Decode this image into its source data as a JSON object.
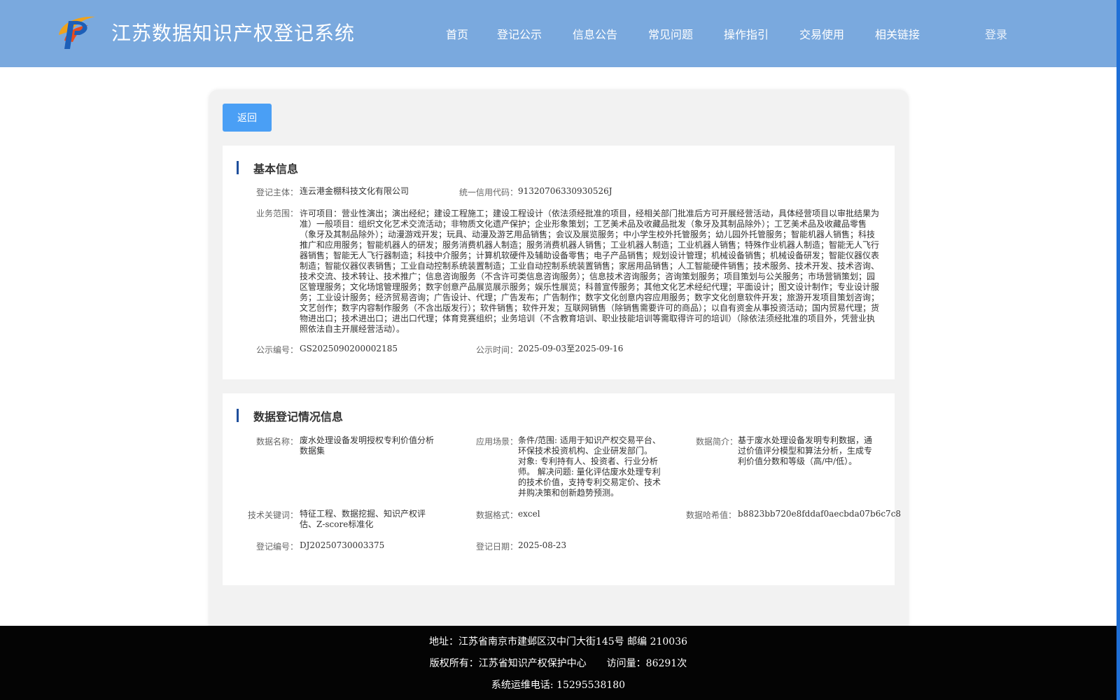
{
  "header": {
    "title": "江苏数据知识产权登记系统",
    "nav": [
      "首页",
      "登记公示",
      "信息公告",
      "常见问题",
      "操作指引",
      "交易使用",
      "相关链接"
    ],
    "login": "登录"
  },
  "toolbar": {
    "back_label": "返回"
  },
  "basic_info": {
    "title": "基本信息",
    "subject_label": "登记主体：",
    "subject": "连云港金棚科技文化有限公司",
    "credit_label": "统一信用代码：",
    "credit_code": "91320706330930526J",
    "scope_label": "业务范围：",
    "scope": "许可项目：营业性演出；演出经纪；建设工程施工；建设工程设计（依法须经批准的项目，经相关部门批准后方可开展经营活动，具体经营项目以审批结果为准）一般项目：组织文化艺术交流活动；非物质文化遗产保护；企业形象策划；工艺美术品及收藏品批发（象牙及其制品除外）；工艺美术品及收藏品零售（象牙及其制品除外）；动漫游戏开发；玩具、动漫及游艺用品销售；会议及展览服务；中小学生校外托管服务；幼儿园外托管服务；智能机器人销售；科技推广和应用服务；智能机器人的研发；服务消费机器人制造；服务消费机器人销售；工业机器人制造；工业机器人销售；特殊作业机器人制造；智能无人飞行器销售；智能无人飞行器制造；科技中介服务；计算机软硬件及辅助设备零售；电子产品销售；规划设计管理；机械设备销售；机械设备研发；智能仪器仪表制造；智能仪器仪表销售；工业自动控制系统装置制造；工业自动控制系统装置销售；家居用品销售；人工智能硬件销售；技术服务、技术开发、技术咨询、技术交流、技术转让、技术推广；信息咨询服务（不含许可类信息咨询服务）；信息技术咨询服务；咨询策划服务；项目策划与公关服务；市场营销策划；园区管理服务；文化场馆管理服务；数字创意产品展览展示服务；娱乐性展览；科普宣传服务；其他文化艺术经纪代理；平面设计；图文设计制作；专业设计服务；工业设计服务；经济贸易咨询；广告设计、代理；广告发布；广告制作；数字文化创意内容应用服务；数字文化创意软件开发；旅游开发项目策划咨询；文艺创作；数字内容制作服务（不含出版发行）；软件销售；软件开发；互联网销售（除销售需要许可的商品）；以自有资金从事投资活动；国内贸易代理；货物进出口；技术进出口；进出口代理；体育竞赛组织；业务培训（不含教育培训、职业技能培训等需取得许可的培训）（除依法须经批准的项目外，凭营业执照依法自主开展经营活动）。",
    "pub_no_label": "公示编号：",
    "pub_no": "GS2025090200002185",
    "pub_time_label": "公示时间：",
    "pub_time": "2025-09-03至2025-09-16"
  },
  "data_info": {
    "title": "数据登记情况信息",
    "name_label": "数据名称：",
    "name": "废水处理设备发明授权专利价值分析数据集",
    "scenario_label": "应用场景：",
    "scenario": "条件/范围: 适用于知识产权交易平台、环保技术投资机构、企业研发部门。 对象: 专利持有人、投资者、行业分析师。 解决问题: 量化评估废水处理专利的技术价值，支持专利交易定价、技术并购决策和创新趋势预测。",
    "intro_label": "数据简介：",
    "intro": "基于废水处理设备发明专利数据，通过价值评分模型和算法分析，生成专利价值分数和等级（高/中/低）。",
    "keywords_label": "技术关键词：",
    "keywords": "特征工程、数据挖掘、知识产权评估、Z-score标准化",
    "format_label": "数据格式：",
    "format": "excel",
    "hash_label": "数据哈希值：",
    "hash": "b8823bb720e8fddaf0aecbda07b6c7c8",
    "reg_no_label": "登记编号：",
    "reg_no": "DJ20250730003375",
    "reg_date_label": "登记日期：",
    "reg_date": "2025-08-23"
  },
  "footer": {
    "address": "地址：江苏省南京市建邺区汉中门大街145号 邮编 210036",
    "copyright": "版权所有：江苏省知识产权保护中心",
    "visits": "访问量：86291次",
    "phone": "系统运维电话: 15295538180"
  },
  "colors": {
    "header_bg": "#7aa9de",
    "button_bg": "#4a9ff5",
    "section_bar": "#1f4f9c",
    "footer_bg": "#040404"
  },
  "icons": {
    "logo": "logo-icon"
  }
}
